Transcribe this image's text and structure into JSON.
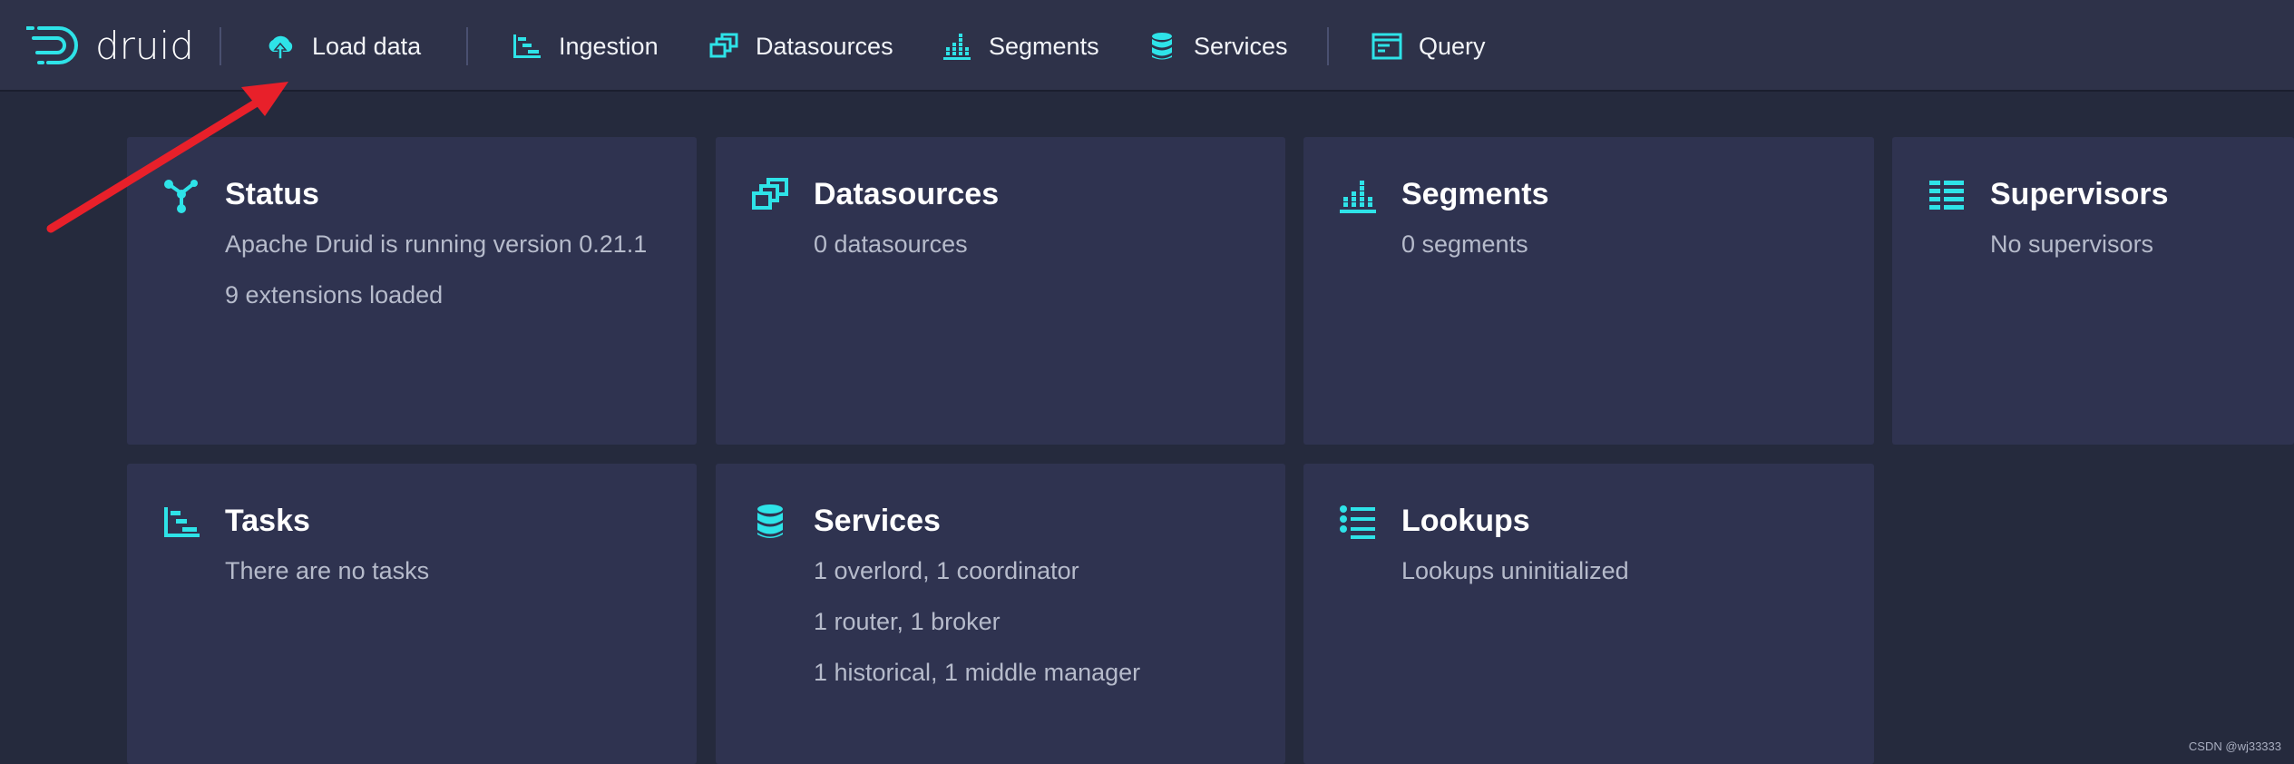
{
  "app": {
    "logo_text": "druid"
  },
  "nav": {
    "load_data": "Load data",
    "ingestion": "Ingestion",
    "datasources": "Datasources",
    "segments": "Segments",
    "services": "Services",
    "query": "Query"
  },
  "cards": {
    "status": {
      "title": "Status",
      "lines": [
        "Apache Druid is running version 0.21.1",
        "9 extensions loaded"
      ]
    },
    "datasources": {
      "title": "Datasources",
      "lines": [
        "0 datasources"
      ]
    },
    "segments": {
      "title": "Segments",
      "lines": [
        "0 segments"
      ]
    },
    "supervisors": {
      "title": "Supervisors",
      "lines": [
        "No supervisors"
      ]
    },
    "tasks": {
      "title": "Tasks",
      "lines": [
        "There are no tasks"
      ]
    },
    "services": {
      "title": "Services",
      "lines": [
        "1 overlord, 1 coordinator",
        "1 router, 1 broker",
        "1 historical, 1 middle manager"
      ]
    },
    "lookups": {
      "title": "Lookups",
      "lines": [
        "Lookups uninitialized"
      ]
    }
  },
  "watermark": "CSDN @wj33333",
  "colors": {
    "accent": "#2ee3e8",
    "background": "#252a3d",
    "navbar": "#2e3249",
    "card": "#2f3350",
    "annotation_arrow": "#e8202a"
  }
}
